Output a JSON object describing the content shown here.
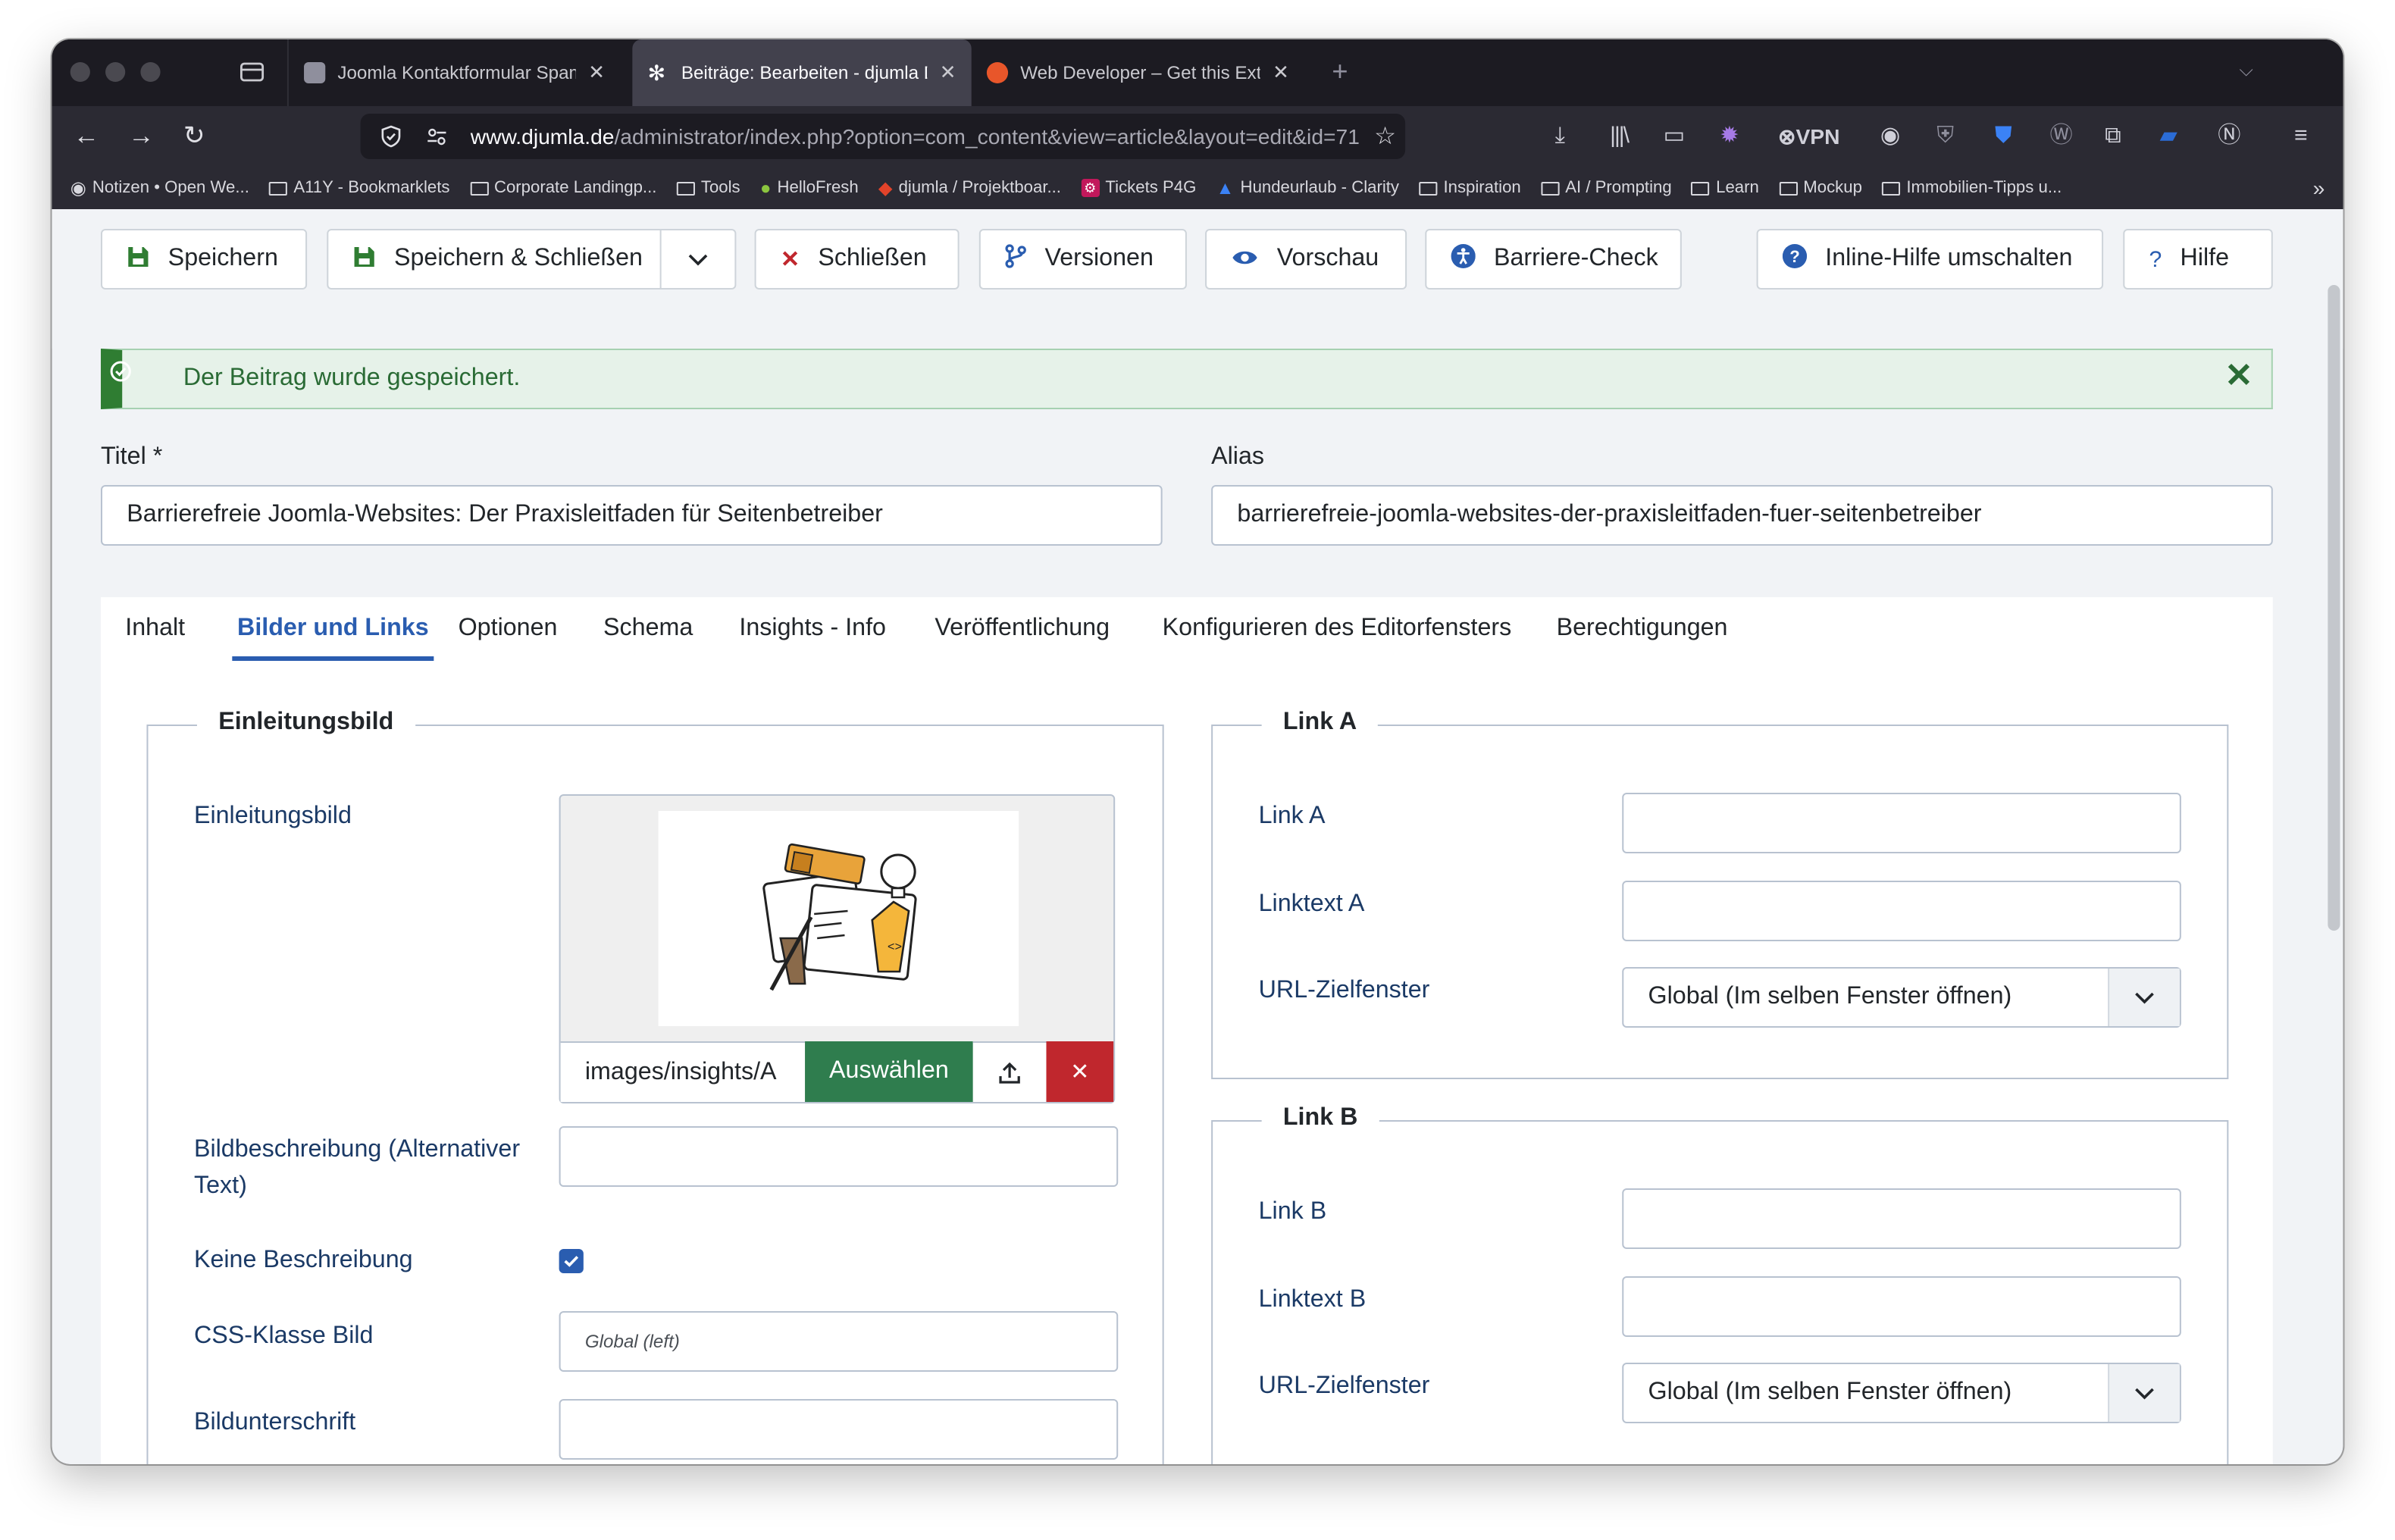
{
  "browser": {
    "tabs": [
      {
        "title": "Joomla Kontaktformular Spam v",
        "active": false
      },
      {
        "title": "Beiträge: Bearbeiten - djumla D",
        "active": true
      },
      {
        "title": "Web Developer – Get this Exten",
        "active": false
      }
    ],
    "url_host": "www.djumla.de",
    "url_path": "/administrator/index.php?option=com_content&view=article&layout=edit&id=71",
    "vpn_label": "VPN",
    "bookmarks": [
      "Notizen • Open We...",
      "A11Y - Bookmarklets",
      "Corporate Landingp...",
      "Tools",
      "HelloFresh",
      "djumla / Projektboar...",
      "Tickets P4G",
      "Hundeurlaub - Clarity",
      "Inspiration",
      "AI / Prompting",
      "Learn",
      "Mockup",
      "Immobilien-Tipps u..."
    ]
  },
  "toolbar": {
    "save": "Speichern",
    "save_close": "Speichern & Schließen",
    "close": "Schließen",
    "versions": "Versionen",
    "preview": "Vorschau",
    "a11y_check": "Barriere-Check",
    "inline_help": "Inline-Hilfe umschalten",
    "help": "Hilfe"
  },
  "alert": {
    "message": "Der Beitrag wurde gespeichert."
  },
  "form": {
    "title_label": "Titel *",
    "title_value": "Barrierefreie Joomla-Websites: Der Praxisleitfaden für Seitenbetreiber",
    "alias_label": "Alias",
    "alias_value": "barrierefreie-joomla-websites-der-praxisleitfaden-fuer-seitenbetreiber"
  },
  "editor_tabs": [
    "Inhalt",
    "Bilder und Links",
    "Optionen",
    "Schema",
    "Insights - Info",
    "Veröffentlichung",
    "Konfigurieren des Editorfensters",
    "Berechtigungen"
  ],
  "intro_image": {
    "legend": "Einleitungsbild",
    "image_label": "Einleitungsbild",
    "image_path": "images/insights/A",
    "select_button": "Auswählen",
    "alt_label": "Bildbeschreibung (Alternativer Text)",
    "alt_value": "",
    "no_desc_label": "Keine Beschreibung",
    "no_desc_checked": true,
    "css_label": "CSS-Klasse Bild",
    "css_placeholder": "Global (left)",
    "caption_label": "Bildunterschrift",
    "caption_value": ""
  },
  "link_a": {
    "legend": "Link A",
    "link_label": "Link A",
    "text_label": "Linktext A",
    "target_label": "URL-Zielfenster",
    "target_value": "Global (Im selben Fenster öffnen)"
  },
  "link_b": {
    "legend": "Link B",
    "link_label": "Link B",
    "text_label": "Linktext B",
    "target_label": "URL-Zielfenster",
    "target_value": "Global (Im selben Fenster öffnen)"
  },
  "colors": {
    "primary": "#2a5db0",
    "success": "#2f7d32",
    "danger": "#c0272d",
    "label": "#1b3a66"
  }
}
